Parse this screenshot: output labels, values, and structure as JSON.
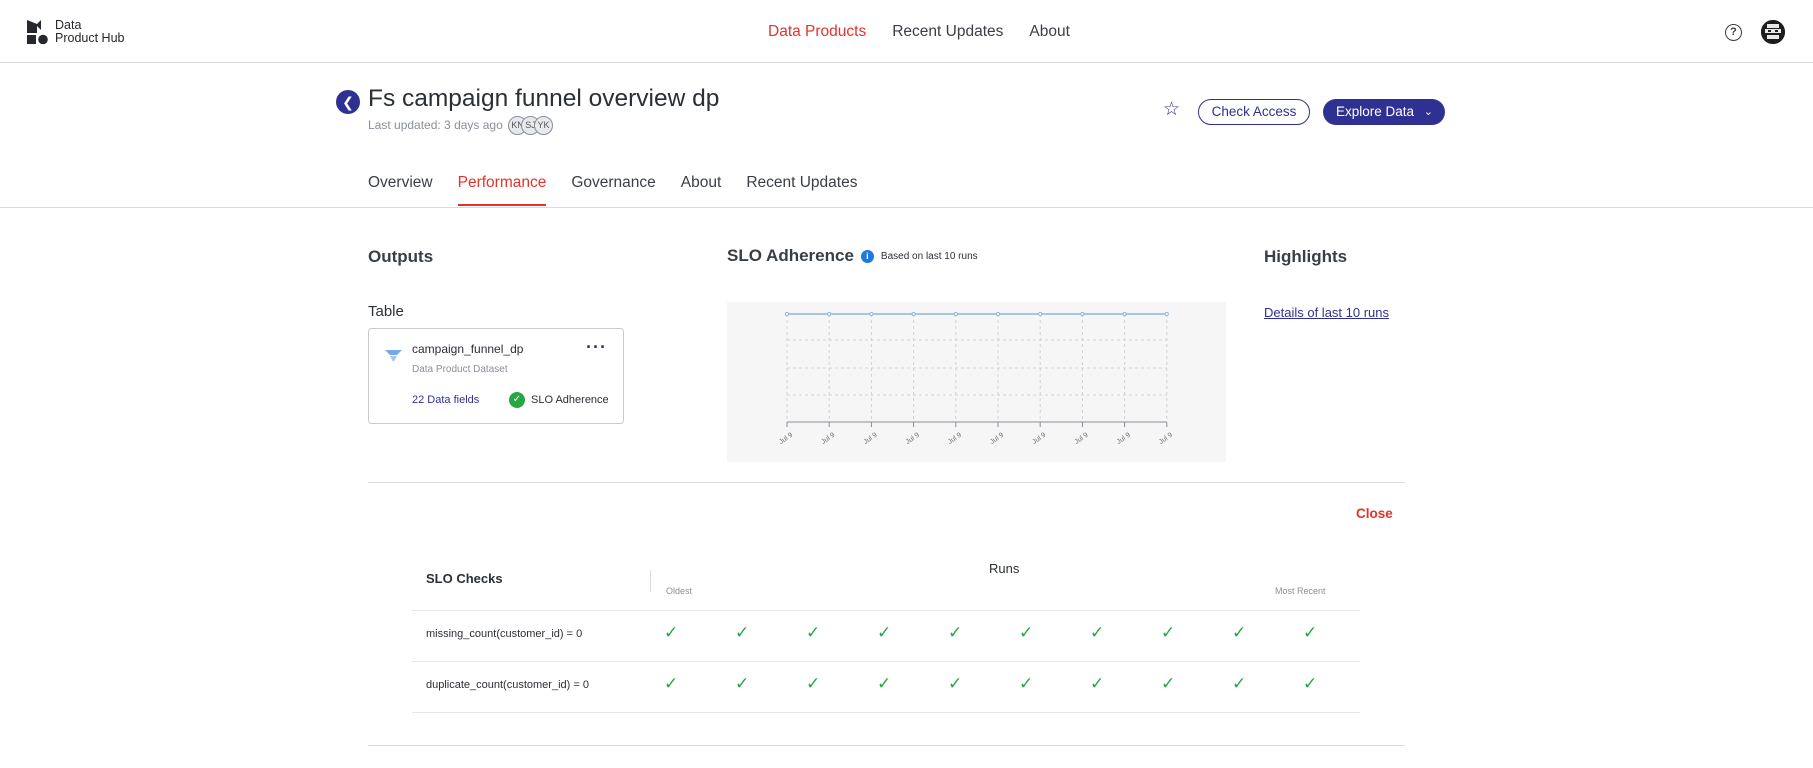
{
  "app": {
    "logo_text_line1": "Data",
    "logo_text_line2": "Product Hub"
  },
  "top_nav": {
    "items": [
      "Data Products",
      "Recent Updates",
      "About"
    ],
    "active": "Data Products",
    "help_icon": "question-circle-icon"
  },
  "header": {
    "title": "Fs campaign funnel overview dp",
    "last_updated": "Last updated: 3 days ago",
    "owners": [
      "KN",
      "SJ",
      "YK"
    ],
    "favorite_icon": "star-outline-icon",
    "check_access_label": "Check Access",
    "explore_data_label": "Explore Data"
  },
  "tabs": {
    "items": [
      "Overview",
      "Performance",
      "Governance",
      "About",
      "Recent Updates"
    ],
    "active": "Performance"
  },
  "outputs": {
    "heading": "Outputs",
    "table_label": "Table",
    "card": {
      "name": "campaign_funnel_dp",
      "subtitle": "Data Product Dataset",
      "fields_link": "22 Data fields",
      "slo_label": "SLO Adherence"
    }
  },
  "slo_adherence": {
    "heading": "SLO Adherence",
    "note": "Based on last 10 runs"
  },
  "highlights": {
    "heading": "Highlights",
    "details_link": "Details of last 10 runs"
  },
  "runs_panel": {
    "close_label": "Close",
    "col_checks": "SLO Checks",
    "col_runs": "Runs",
    "oldest_label": "Oldest",
    "recent_label": "Most Recent",
    "rows": [
      {
        "check": "missing_count(customer_id) = 0",
        "results": [
          true,
          true,
          true,
          true,
          true,
          true,
          true,
          true,
          true,
          true
        ]
      },
      {
        "check": "duplicate_count(customer_id) = 0",
        "results": [
          true,
          true,
          true,
          true,
          true,
          true,
          true,
          true,
          true,
          true
        ]
      }
    ]
  },
  "colors": {
    "accent_red": "#e2342b",
    "brand_navy": "#2e3192",
    "success_green": "#27a644",
    "chart_line": "#8fb3dd"
  },
  "chart_data": {
    "type": "line",
    "x": [
      "Jul 9",
      "Jul 9",
      "Jul 9",
      "Jul 9",
      "Jul 9",
      "Jul 9",
      "Jul 9",
      "Jul 9",
      "Jul 9",
      "Jul 9"
    ],
    "series": [
      {
        "values": [
          100,
          100,
          100,
          100,
          100,
          100,
          100,
          100,
          100,
          100
        ]
      }
    ],
    "ylim": [
      0,
      100
    ],
    "grid": true
  }
}
